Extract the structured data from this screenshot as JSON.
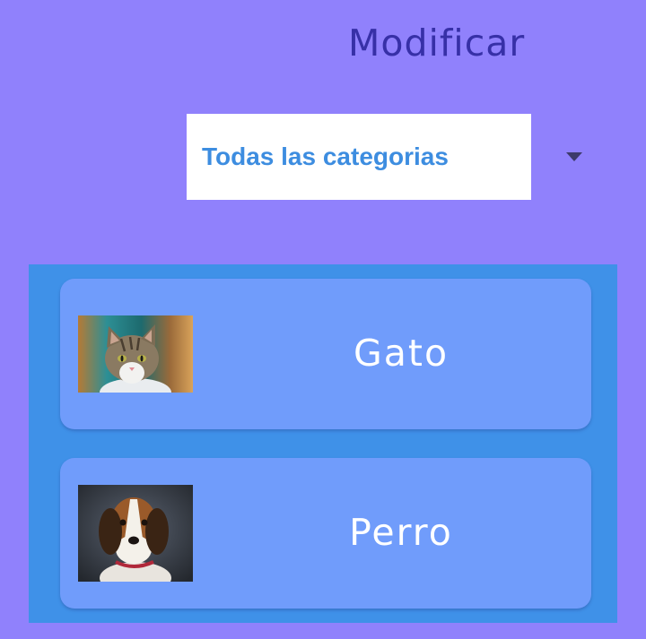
{
  "header": {
    "title": "Modificar"
  },
  "category_select": {
    "selected": "Todas las categorias",
    "arrow_icon": "caret-down-icon"
  },
  "categories": [
    {
      "label": "Gato",
      "image": "cat-photo"
    },
    {
      "label": "Perro",
      "image": "dog-photo"
    }
  ],
  "colors": {
    "background": "#9081fc",
    "title": "#3730a7",
    "select_text": "#3d8de0",
    "panel": "#3f91e8",
    "card": "#709cfb",
    "card_text": "#ffffff"
  }
}
